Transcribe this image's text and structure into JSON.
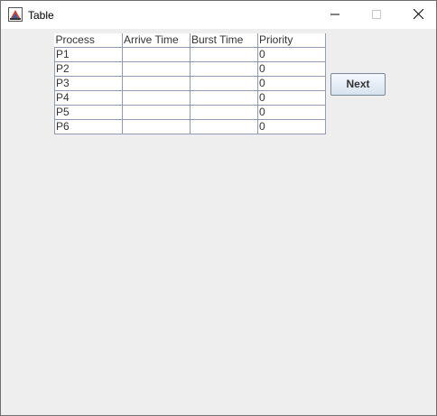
{
  "window": {
    "title": "Table"
  },
  "table": {
    "columns": [
      "Process",
      "Arrive Time",
      "Burst Time",
      "Priority"
    ],
    "rows": [
      {
        "process": "P1",
        "arrive": "",
        "burst": "",
        "priority": "0"
      },
      {
        "process": "P2",
        "arrive": "",
        "burst": "",
        "priority": "0"
      },
      {
        "process": "P3",
        "arrive": "",
        "burst": "",
        "priority": "0"
      },
      {
        "process": "P4",
        "arrive": "",
        "burst": "",
        "priority": "0"
      },
      {
        "process": "P5",
        "arrive": "",
        "burst": "",
        "priority": "0"
      },
      {
        "process": "P6",
        "arrive": "",
        "burst": "",
        "priority": "0"
      }
    ]
  },
  "buttons": {
    "next_label": "Next"
  },
  "icons": {
    "app": "java-app-icon",
    "minimize": "minimize-icon",
    "maximize": "maximize-icon",
    "close": "close-icon"
  },
  "colors": {
    "grid": "#8e9bb3",
    "window_bg": "#eeeeee",
    "titlebar_bg": "#ffffff"
  }
}
